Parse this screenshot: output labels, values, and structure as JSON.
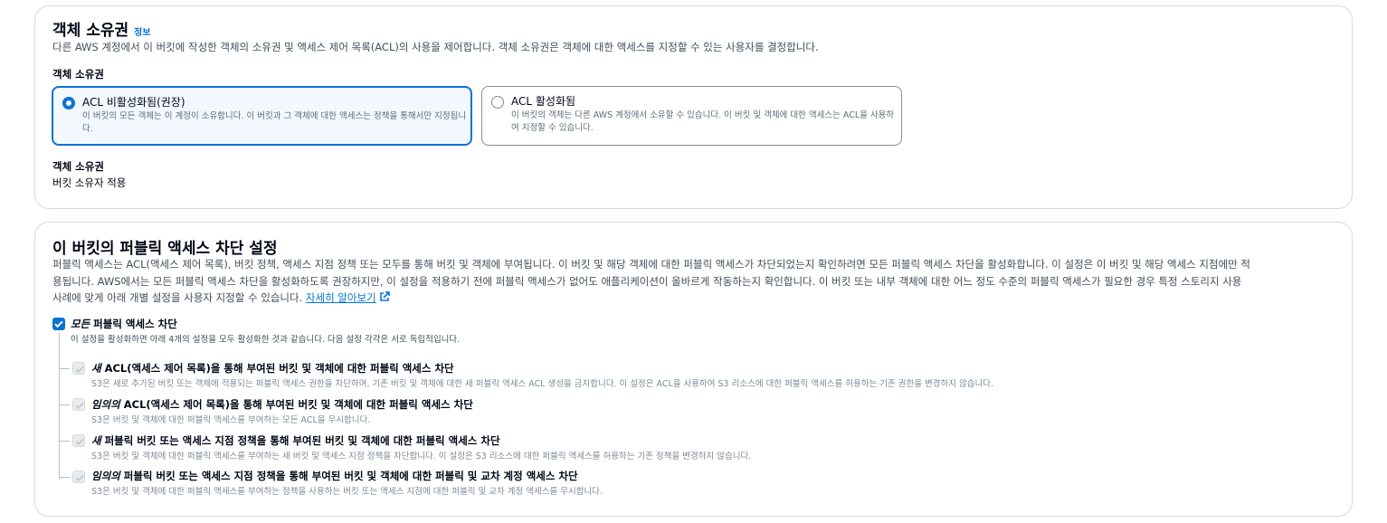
{
  "ownership": {
    "heading": "객체 소유권",
    "info_link": "정보",
    "description": "다른 AWS 계정에서 이 버킷에 작성한 객체의 소유권 및 액세스 제어 목록(ACL)의 사용을 제어합니다. 객체 소유권은 객체에 대한 액세스를 지정할 수 있는 사용자를 결정합니다.",
    "field_label": "객체 소유권",
    "options": [
      {
        "title": "ACL 비활성화됨(권장)",
        "description": "이 버킷의 모든 객체는 이 계정이 소유합니다. 이 버킷과 그 객체에 대한 액세스는 정책을 통해서만 지정됩니다.",
        "selected": true
      },
      {
        "title": "ACL 활성화됨",
        "description": "이 버킷의 객체는 다른 AWS 계정에서 소유할 수 있습니다. 이 버킷 및 객체에 대한 액세스는 ACL을 사용하여 지정할 수 있습니다.",
        "selected": false
      }
    ],
    "result_label": "객체 소유권",
    "result_value": "버킷 소유자 적용"
  },
  "public_access": {
    "heading": "이 버킷의 퍼블릭 액세스 차단 설정",
    "description_line1": "퍼블릭 액세스는 ACL(액세스 제어 목록), 버킷 정책, 액세스 지점 정책 또는 모두를 통해 버킷 및 객체에 부여됩니다. 이 버킷 및 해당 객체에 대한 퍼블릭 액세스가 차단되었는지 확인하려면 모든 퍼블릭 액세스 차단을 활성화합니다. 이 설정은 이 버킷 및 해당 액세스 지점에만 적",
    "description_line2": "용됩니다. AWS에서는 모든 퍼블릭 액세스 차단을 활성화하도록 권장하지만, 이 설정을 적용하기 전에 퍼블릭 액세스가 없어도 애플리케이션이 올바르게 작동하는지 확인합니다. 이 버킷 또는 내부 객체에 대한 어느 정도 수준의 퍼블릭 액세스가 필요한 경우 특정 스토리지 사용",
    "description_line3": "사례에 맞게 아래 개별 설정을 사용자 지정할 수 있습니다.",
    "learn_more": "자세히 알아보기",
    "block_all": {
      "title_em": "모든",
      "title_rest": " 퍼블릭 액세스 차단",
      "description": "이 설정을 활성화하면 아래 4개의 설정을 모두 활성화한 것과 같습니다. 다음 설정 각각은 서로 독립적입니다.",
      "checked": true
    },
    "settings": [
      {
        "title_em": "새",
        "title_rest": " ACL(액세스 제어 목록)을 통해 부여된 버킷 및 객체에 대한 퍼블릭 액세스 차단",
        "description": "S3은 새로 추가된 버킷 또는 객체에 적용되는 퍼블릭 액세스 권한을 차단하며, 기존 버킷 및 객체에 대한 새 퍼블릭 액세스 ACL 생성을 금지합니다. 이 설정은 ACL을 사용하여 S3 리소스에 대한 퍼블릭 액세스를 허용하는 기존 권한을 변경하지 않습니다."
      },
      {
        "title_em": "임의의",
        "title_rest": " ACL(액세스 제어 목록)을 통해 부여된 버킷 및 객체에 대한 퍼블릭 액세스 차단",
        "description": "S3은 버킷 및 객체에 대한 퍼블릭 액세스를 부여하는 모든 ACL을 무시합니다."
      },
      {
        "title_em": "새",
        "title_rest": " 퍼블릭 버킷 또는 액세스 지점 정책을 통해 부여된 버킷 및 객체에 대한 퍼블릭 액세스 차단",
        "description": "S3은 버킷 및 객체에 대한 퍼블릭 액세스를 부여하는 새 버킷 및 액세스 지점 정책을 차단합니다. 이 설정은 S3 리소스에 대한 퍼블릭 액세스를 허용하는 기존 정책을 변경하지 않습니다."
      },
      {
        "title_em": "임의의",
        "title_rest": " 퍼블릭 버킷 또는 액세스 지점 정책을 통해 부여된 버킷 및 객체에 대한 퍼블릭 및 교차 계정 액세스 차단",
        "description": "S3은 버킷 및 객체에 대한 퍼블릭 액세스를 부여하는 정책을 사용하는 버킷 또는 액세스 지점에 대한 퍼블릭 및 교차 계정 액세스를 무시합니다."
      }
    ]
  },
  "colors": {
    "accent": "#0972d3",
    "border": "#d5dbdb",
    "selected_bg": "#f2f8fd"
  }
}
